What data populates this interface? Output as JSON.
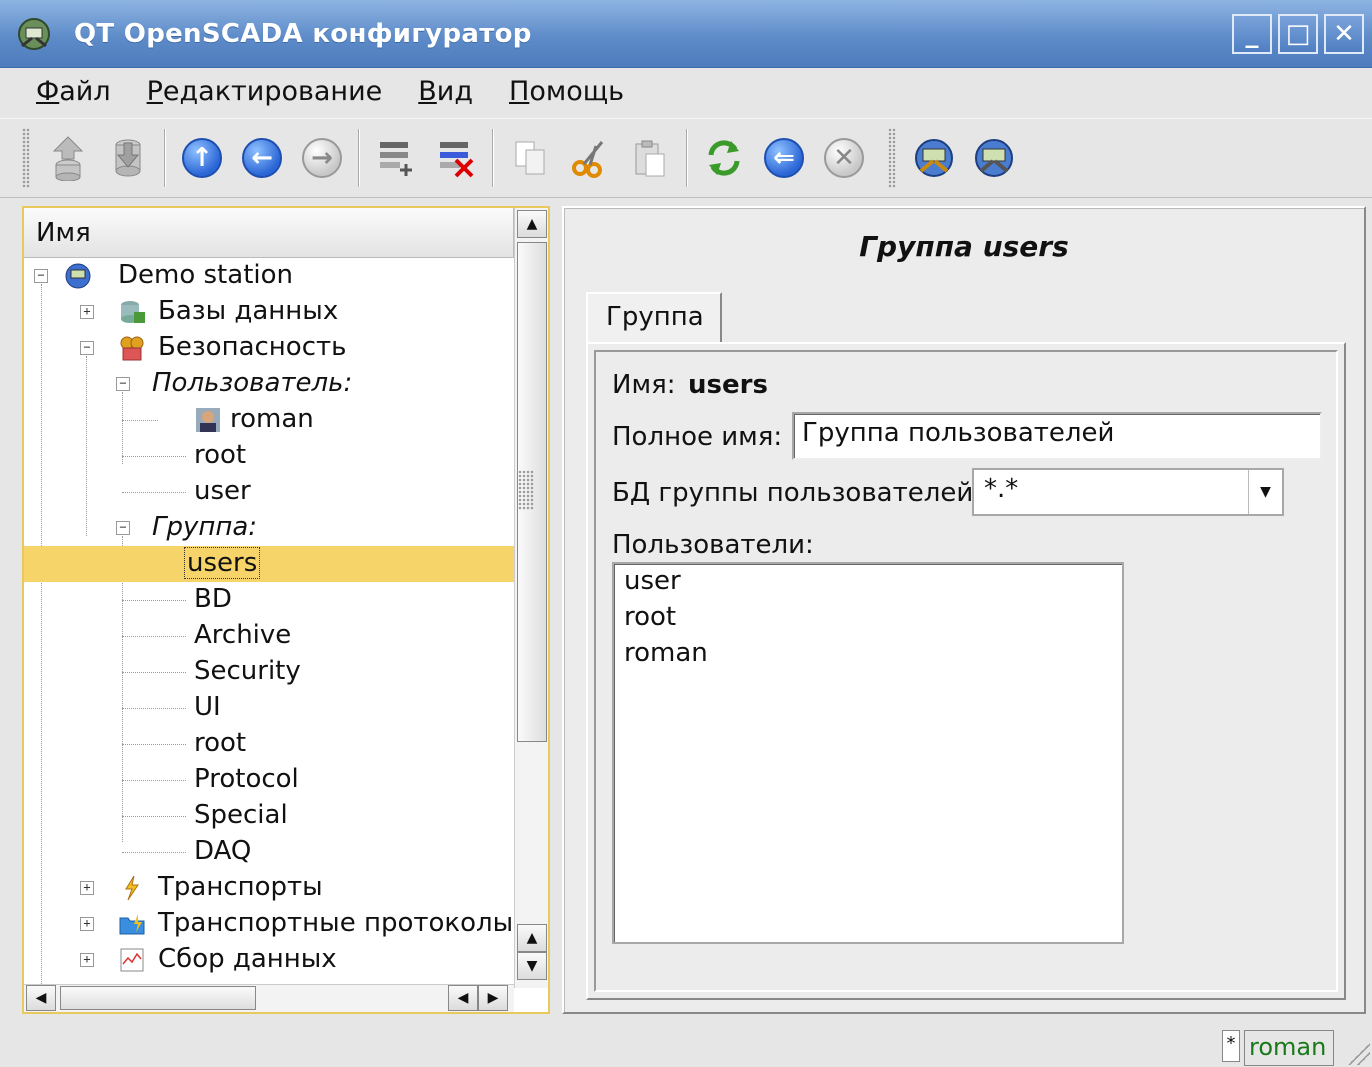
{
  "window": {
    "title": "QT OpenSCADA конфигуратор",
    "minimize": "_",
    "maximize": "□",
    "close": "✕"
  },
  "menu": [
    {
      "label_u": "Ф",
      "label_rest": "айл"
    },
    {
      "label_u": "Р",
      "label_rest": "едактирование"
    },
    {
      "label_u": "В",
      "label_rest": "ид"
    },
    {
      "label_u": "П",
      "label_rest": "омощь"
    }
  ],
  "tree": {
    "header": "Имя",
    "rows": [
      {
        "label": "Demo station",
        "italic": false
      },
      {
        "label": "Базы данных",
        "italic": false
      },
      {
        "label": "Безопасность",
        "italic": false
      },
      {
        "label": "Пользователь:",
        "italic": true
      },
      {
        "label": "roman",
        "italic": false
      },
      {
        "label": "root",
        "italic": false
      },
      {
        "label": "user",
        "italic": false
      },
      {
        "label": "Группа:",
        "italic": true
      },
      {
        "label": "users",
        "italic": false,
        "selected": true
      },
      {
        "label": "BD",
        "italic": false
      },
      {
        "label": "Archive",
        "italic": false
      },
      {
        "label": "Security",
        "italic": false
      },
      {
        "label": "UI",
        "italic": false
      },
      {
        "label": "root",
        "italic": false
      },
      {
        "label": "Protocol",
        "italic": false
      },
      {
        "label": "Special",
        "italic": false
      },
      {
        "label": "DAQ",
        "italic": false
      },
      {
        "label": "Транспорты",
        "italic": false
      },
      {
        "label": "Транспортные протоколы",
        "italic": false
      },
      {
        "label": "Сбор данных",
        "italic": false
      }
    ]
  },
  "page": {
    "title": "Группа users",
    "tab": "Группа",
    "name_label": "Имя:",
    "name_value": "users",
    "fullname_label": "Полное имя:",
    "fullname_value": "Группа пользователей",
    "db_label": "БД группы пользователей:",
    "db_value": "*.*",
    "users_label": "Пользователи:",
    "users": [
      "user",
      "root",
      "roman"
    ]
  },
  "status": {
    "modified": "*",
    "user": "roman"
  },
  "colors": {
    "selection": "#f7d46a",
    "title_bar": "#5e8cc9",
    "status_user": "#1a7a1a"
  }
}
